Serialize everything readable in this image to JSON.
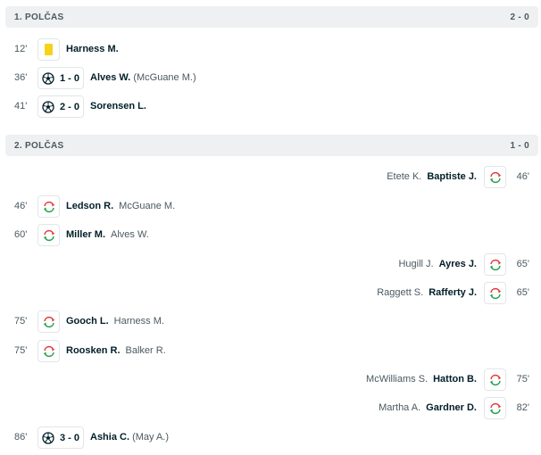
{
  "periods": [
    {
      "title": "1. POLČAS",
      "score": "2 - 0"
    },
    {
      "title": "2. POLČAS",
      "score": "1 - 0"
    }
  ],
  "first_half": [
    {
      "minute": "12'",
      "icon": "yellow-card-icon",
      "player": "Harness M."
    },
    {
      "minute": "36'",
      "icon": "soccer-ball-icon",
      "score": "1 - 0",
      "player": "Alves W.",
      "assist": "(McGuane M.)"
    },
    {
      "minute": "41'",
      "icon": "soccer-ball-icon",
      "score": "2 - 0",
      "player": "Sorensen L.",
      "assist": ""
    }
  ],
  "second_half": [
    {
      "side": "away",
      "minute": "46'",
      "icon": "substitution-icon",
      "player_in": "Baptiste J.",
      "player_out": "Etete K."
    },
    {
      "side": "home",
      "minute": "46'",
      "icon": "substitution-icon",
      "player_in": "Ledson R.",
      "player_out": "McGuane M."
    },
    {
      "side": "home",
      "minute": "60'",
      "icon": "substitution-icon",
      "player_in": "Miller M.",
      "player_out": "Alves W."
    },
    {
      "side": "away",
      "minute": "65'",
      "icon": "substitution-icon",
      "player_in": "Ayres J.",
      "player_out": "Hugill J."
    },
    {
      "side": "away",
      "minute": "65'",
      "icon": "substitution-icon",
      "player_in": "Rafferty J.",
      "player_out": "Raggett S."
    },
    {
      "side": "home",
      "minute": "75'",
      "icon": "substitution-icon",
      "player_in": "Gooch L.",
      "player_out": "Harness M."
    },
    {
      "side": "home",
      "minute": "75'",
      "icon": "substitution-icon",
      "player_in": "Roosken R.",
      "player_out": "Balker R."
    },
    {
      "side": "away",
      "minute": "75'",
      "icon": "substitution-icon",
      "player_in": "Hatton B.",
      "player_out": "McWilliams S."
    },
    {
      "side": "away",
      "minute": "82'",
      "icon": "substitution-icon",
      "player_in": "Gardner D.",
      "player_out": "Martha A."
    },
    {
      "side": "home",
      "minute": "86'",
      "icon": "soccer-ball-icon",
      "score": "3 - 0",
      "player": "Ashia C.",
      "assist": "(May A.)"
    }
  ],
  "colors": {
    "yellow_card": "#f6d31a",
    "sub_in": "#22a34a",
    "sub_out": "#e03a3a",
    "header_bg": "#eef0f1"
  }
}
